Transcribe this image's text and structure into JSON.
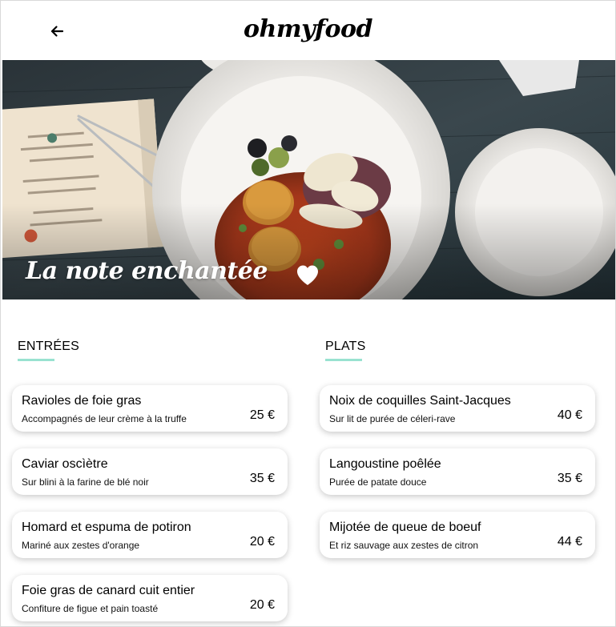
{
  "header": {
    "logo": "ohmyfood",
    "back_icon": "arrow-left-icon"
  },
  "hero": {
    "title": "La note enchantée",
    "favorite_icon": "heart-icon",
    "colors": {
      "title": "#ffffff",
      "heart": "#ffffff"
    }
  },
  "menu": {
    "accent_color": "#99e2d0",
    "entrees": {
      "title": "ENTRÉES",
      "items": [
        {
          "name": "Ravioles de foie gras",
          "description": "Accompagnés de leur crème à la truffe",
          "price": "25 €"
        },
        {
          "name": "Caviar oscìètre",
          "description": "Sur blini à la farine de blé noir",
          "price": "35 €"
        },
        {
          "name": "Homard et espuma de potiron",
          "description": "Mariné aux zestes d'orange",
          "price": "20 €"
        },
        {
          "name": "Foie gras de canard cuit entier",
          "description": "Confiture de figue et pain toasté",
          "price": "20 €"
        }
      ]
    },
    "plats": {
      "title": "PLATS",
      "items": [
        {
          "name": "Noix de coquilles Saint-Jacques",
          "description": "Sur lit de purée de céleri-rave",
          "price": "40 €"
        },
        {
          "name": "Langoustine poêlée",
          "description": "Purée de patate douce",
          "price": "35 €"
        },
        {
          "name": "Mijotée de queue de boeuf",
          "description": "Et riz sauvage aux zestes de citron",
          "price": "44 €"
        }
      ]
    }
  }
}
